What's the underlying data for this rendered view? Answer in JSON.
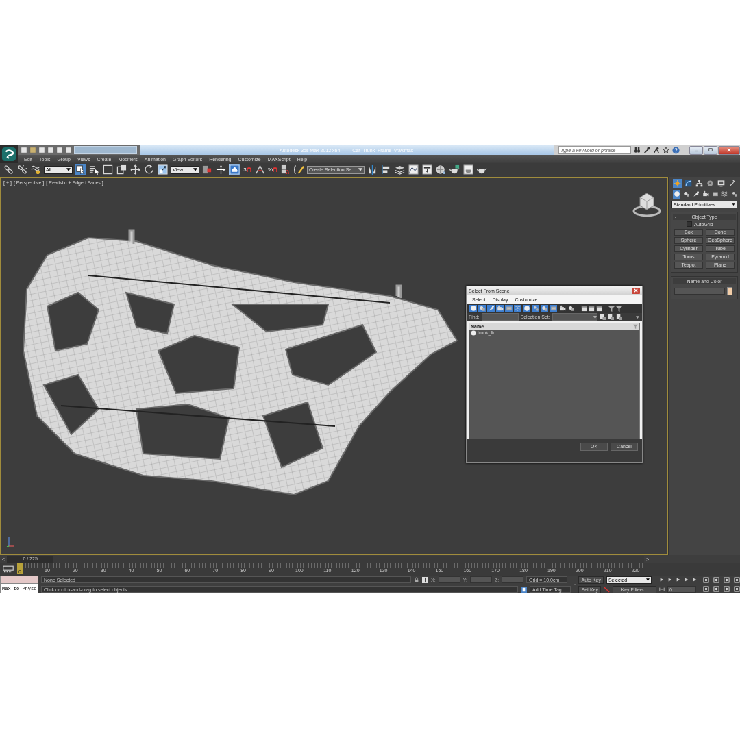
{
  "title_bar": {
    "app": "Autodesk 3ds Max 2012 x64",
    "document": "Car_Trunk_Frame_vray.max",
    "search": {
      "placeholder": "Type a keyword or phrase"
    }
  },
  "menu": [
    "Edit",
    "Tools",
    "Group",
    "Views",
    "Create",
    "Modifiers",
    "Animation",
    "Graph Editors",
    "Rendering",
    "Customize",
    "MAXScript",
    "Help"
  ],
  "toolbar": [
    {
      "kind": "link",
      "active": false
    },
    {
      "kind": "unlink",
      "active": false
    },
    {
      "kind": "bind",
      "active": false
    },
    {
      "kind": "dropdown",
      "value": "All"
    },
    {
      "kind": "select",
      "active": true
    },
    {
      "kind": "select-name",
      "active": false
    },
    {
      "kind": "rect",
      "active": false
    },
    {
      "kind": "window",
      "active": false
    },
    {
      "kind": "move",
      "active": false
    },
    {
      "kind": "rotate",
      "active": false
    },
    {
      "kind": "scale",
      "active": false
    },
    {
      "kind": "dropdown",
      "value": "View"
    },
    {
      "kind": "pivot",
      "active": false
    },
    {
      "kind": "manipulate",
      "active": false
    },
    {
      "kind": "keyboard",
      "active": true
    },
    {
      "kind": "snap",
      "label": "3",
      "active": false
    },
    {
      "kind": "angle",
      "active": false
    },
    {
      "kind": "snap",
      "label": "%",
      "active": false
    },
    {
      "kind": "spinner",
      "active": false
    },
    {
      "kind": "edit-named",
      "active": false
    },
    {
      "kind": "dropdown",
      "value": "Create Selection Se"
    },
    {
      "kind": "mirror",
      "active": false
    },
    {
      "kind": "align",
      "active": false
    },
    {
      "kind": "layers",
      "active": false
    },
    {
      "kind": "curve",
      "active": false
    },
    {
      "kind": "schematic",
      "active": false
    },
    {
      "kind": "material",
      "active": false
    },
    {
      "kind": "render-setup",
      "active": false
    },
    {
      "kind": "frame-window",
      "active": false
    },
    {
      "kind": "render",
      "active": false
    }
  ],
  "viewport": {
    "labels": [
      "[ + ]",
      "[ Perspective ]",
      "[ Realistic + Edged Faces ]"
    ]
  },
  "command_panel": {
    "tabs": [
      {
        "kind": "create",
        "selected": true
      },
      {
        "kind": "modify",
        "selected": false
      },
      {
        "kind": "hierarchy",
        "selected": false
      },
      {
        "kind": "motion",
        "selected": false
      },
      {
        "kind": "display",
        "selected": false
      },
      {
        "kind": "utilities",
        "selected": false
      }
    ],
    "subtabs": [
      {
        "kind": "geometry",
        "selected": true
      },
      {
        "kind": "shapes",
        "selected": false
      },
      {
        "kind": "lights",
        "selected": false
      },
      {
        "kind": "cameras",
        "selected": false
      },
      {
        "kind": "helpers",
        "selected": false
      },
      {
        "kind": "spacewarps",
        "selected": false
      },
      {
        "kind": "systems",
        "selected": false
      }
    ],
    "category": "Standard Primitives",
    "object_type": {
      "toggle": "-",
      "title": "Object Type",
      "autogrid": {
        "label": "AutoGrid",
        "checked": false
      },
      "buttons": [
        "Box",
        "Cone",
        "Sphere",
        "GeoSphere",
        "Cylinder",
        "Tube",
        "Torus",
        "Pyramid",
        "Teapot",
        "Plane"
      ]
    },
    "name_and_color": {
      "toggle": "-",
      "title": "Name and Color",
      "color": "#f2cda8"
    }
  },
  "dialog": {
    "title": "Select From Scene",
    "menu": [
      "Select",
      "Display",
      "Customize"
    ],
    "filters": [
      {
        "on": true
      },
      {
        "on": true
      },
      {
        "on": true
      },
      {
        "on": true
      },
      {
        "on": true
      },
      {
        "on": true
      },
      {
        "on": true
      },
      {
        "on": true
      },
      {
        "on": true
      },
      {
        "on": true
      },
      {
        "on": false
      },
      {
        "on": false
      }
    ],
    "find_label": "Find:",
    "selection_set_label": "Selection Set:",
    "column": "Name",
    "rows": [
      {
        "name": "trunk_lid",
        "selected": false
      }
    ],
    "buttons": [
      "OK",
      "Cancel"
    ]
  },
  "time_slider": {
    "prev": "<",
    "position": "0 / 225",
    "next": ">"
  },
  "track_bar": {
    "current": "0",
    "ticks": [
      "10",
      "20",
      "30",
      "40",
      "50",
      "60",
      "70",
      "80",
      "90",
      "100",
      "110",
      "120",
      "130",
      "140",
      "150",
      "160",
      "170",
      "180",
      "190",
      "200",
      "210",
      "220"
    ]
  },
  "status": {
    "listener": "Max to Physc.",
    "selection": "None Selected",
    "prompt": "Click or click-and-drag to select objects",
    "x_label": "X:",
    "y_label": "Y:",
    "z_label": "Z:",
    "grid": "Grid = 10,0cm",
    "time_tag": "Add Time Tag"
  },
  "animation": {
    "auto_key": "Auto Key",
    "key_mode": "Selected",
    "set_key": "Set Key",
    "key_filters": "Key Filters...",
    "frame": "0"
  }
}
